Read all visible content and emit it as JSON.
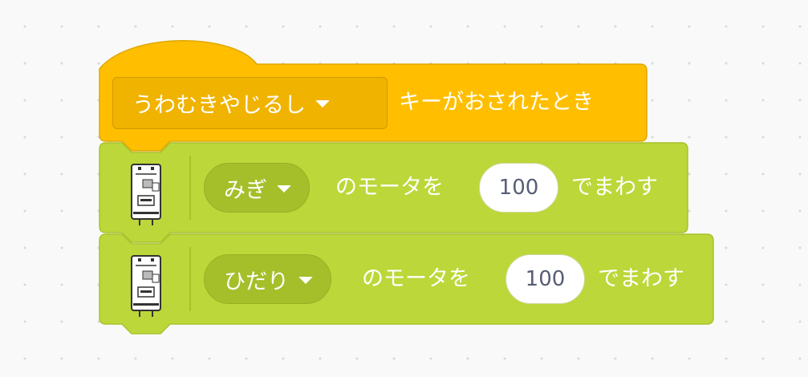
{
  "blocks": {
    "hat": {
      "dropdown_value": "うわむきやじるし",
      "label": "キーがおされたとき",
      "color": "#ffbf00"
    },
    "motor_blocks": [
      {
        "side_value": "みぎ",
        "label_before": "のモータを",
        "power": "100",
        "label_after": "でまわす",
        "color": "#bcd739"
      },
      {
        "side_value": "ひだり",
        "label_before": "のモータを",
        "power": "100",
        "label_after": "でまわす",
        "color": "#bcd739"
      }
    ],
    "icons": {
      "device": "microcontroller-board-icon",
      "dropdown": "caret-down-icon"
    }
  }
}
